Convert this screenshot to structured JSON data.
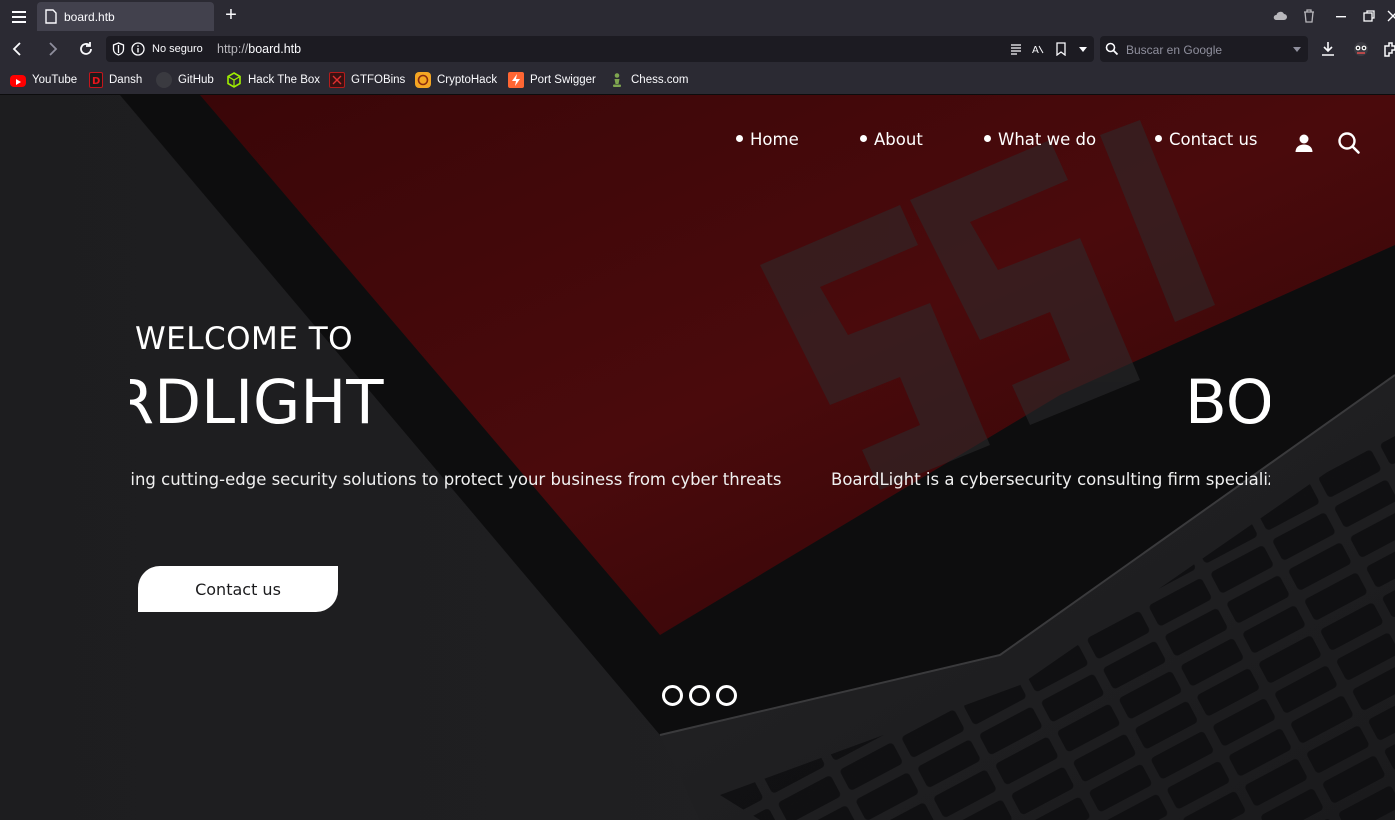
{
  "browser": {
    "tab_title": "board.htb",
    "security_label": "No seguro",
    "url_scheme": "http://",
    "url_host": "board.htb",
    "search_placeholder": "Buscar en Google"
  },
  "bookmarks": [
    {
      "label": "YouTube",
      "icon": "youtube-icon",
      "color": "#ff0000"
    },
    {
      "label": "Dansh",
      "icon": "dansh-icon",
      "color": "#c4151c"
    },
    {
      "label": "GitHub",
      "icon": "github-icon",
      "color": "#24292e"
    },
    {
      "label": "Hack The Box",
      "icon": "hackthebox-icon",
      "color": "#9fef00"
    },
    {
      "label": "GTFOBins",
      "icon": "gtfobins-icon",
      "color": "#b51c1c"
    },
    {
      "label": "CryptoHack",
      "icon": "cryptohack-icon",
      "color": "#f5a623"
    },
    {
      "label": "Port Swigger",
      "icon": "portswigger-icon",
      "color": "#ff6633"
    },
    {
      "label": "Chess.com",
      "icon": "chess-icon",
      "color": "#7fa650"
    }
  ],
  "site": {
    "nav": [
      "Home",
      "About",
      "What we do",
      "Contact us"
    ],
    "hero": {
      "welcome": "WELCOME TO",
      "title_current": "ARDLIGHT",
      "title_next": "BO",
      "desc_current": "g in providing cutting-edge security solutions to protect your business from cyber threats",
      "desc_next": "BoardLight is a cybersecurity consulting firm specializin",
      "cta": "Contact us"
    },
    "colors": {
      "accent": "#ffffff",
      "background": "#1b1b1d",
      "laptop_red": "#5a0c0c"
    }
  }
}
